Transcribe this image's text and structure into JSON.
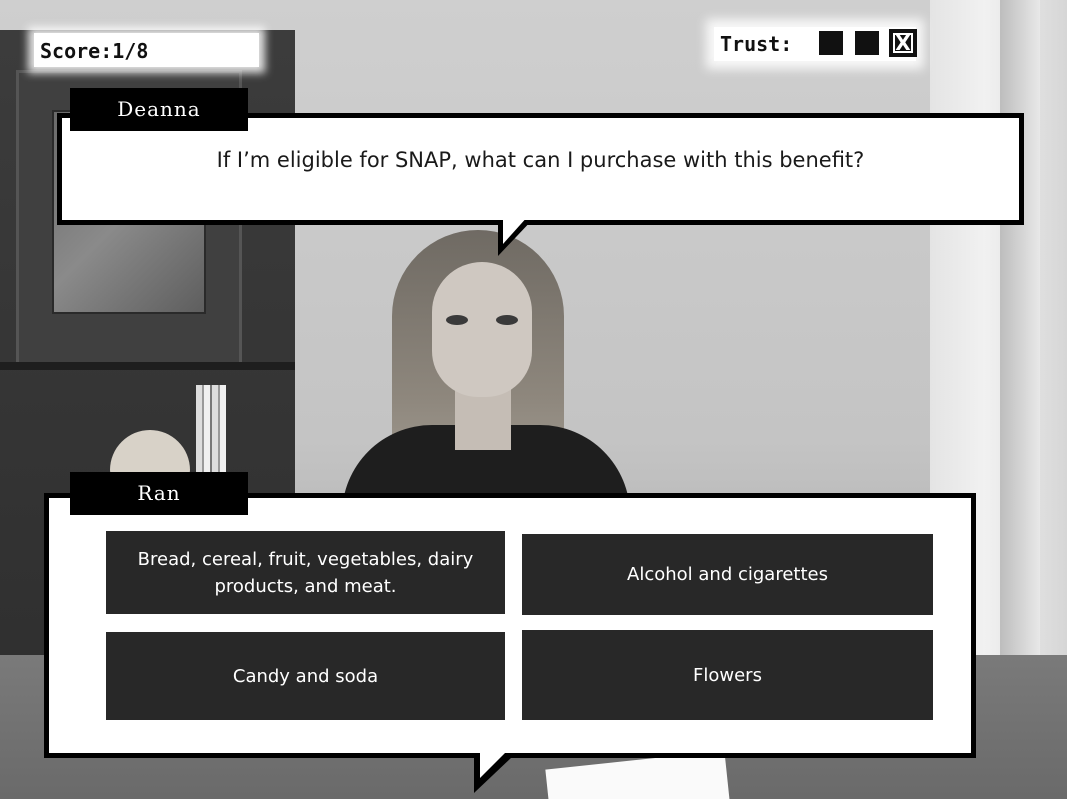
{
  "hud": {
    "score_text": "Score:1/8",
    "trust_label": "Trust:",
    "trust_meter": [
      {
        "state": "filled",
        "icon": "filled-square-icon"
      },
      {
        "state": "filled",
        "icon": "filled-square-icon"
      },
      {
        "state": "lost",
        "icon": "x-mark-icon",
        "glyph": "X"
      }
    ]
  },
  "npc": {
    "name": "Deanna",
    "question": "If I’m eligible for SNAP, what can I purchase with this benefit?"
  },
  "player": {
    "name": "Ran",
    "answers": [
      "Bread, cereal, fruit, vegetables, dairy products, and meat.",
      "Alcohol and cigarettes",
      "Candy and soda",
      "Flowers"
    ]
  },
  "colors": {
    "answer_background": "#282828",
    "answer_text": "#ffffff",
    "bubble_border": "#000000",
    "bubble_fill": "#ffffff"
  }
}
